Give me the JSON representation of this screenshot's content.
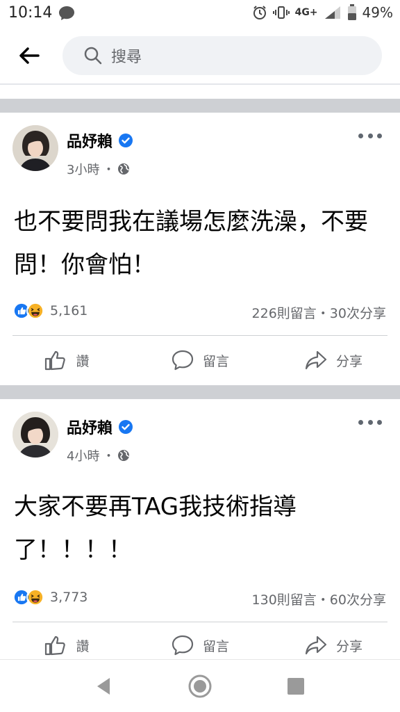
{
  "status": {
    "time": "10:14",
    "network": "4G+",
    "battery": "49%"
  },
  "search": {
    "placeholder": "搜尋"
  },
  "posts": [
    {
      "author": "品妤賴",
      "time": "3小時",
      "text": "也不要問我在議場怎麼洗澡，不要問！你會怕！",
      "reaction_count": "5,161",
      "engagement": "226則留言・30次分享",
      "actions": {
        "like": "讚",
        "comment": "留言",
        "share": "分享"
      }
    },
    {
      "author": "品妤賴",
      "time": "4小時",
      "text": "大家不要再TAG我技術指導了！！！！",
      "reaction_count": "3,773",
      "engagement": "130則留言・60次分享",
      "actions": {
        "like": "讚",
        "comment": "留言",
        "share": "分享"
      }
    }
  ],
  "colors": {
    "accent": "#1877f2",
    "secondary_text": "#65676b",
    "separator": "#ced0d4"
  },
  "icons": [
    "back-arrow-icon",
    "search-icon",
    "verified-badge-icon",
    "globe-icon",
    "more-icon",
    "like-reaction-icon",
    "haha-reaction-icon",
    "thumbs-up-icon",
    "comment-icon",
    "share-icon"
  ]
}
